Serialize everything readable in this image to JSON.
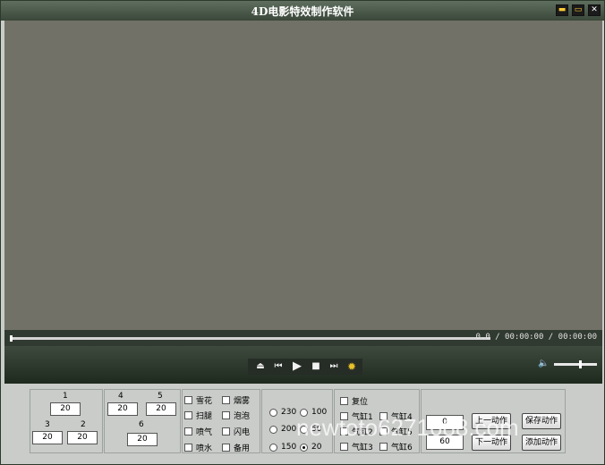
{
  "window": {
    "title": "4D电影特效制作软件",
    "min_icon": "▬",
    "max_icon": "▭",
    "close_icon": "✕"
  },
  "playback": {
    "time_text": "0.0 / 00:00:00 / 00:00:00",
    "progress": 0.0,
    "volume": 0.62,
    "icons": {
      "eject": "⏏",
      "prev": "⏮",
      "play": "▶",
      "stop": "■",
      "next": "⏭",
      "settings": "✹",
      "volume": "🔈"
    }
  },
  "panel": {
    "group1": {
      "label_1": "1",
      "value_1": "20",
      "label_3": "3",
      "value_3": "20",
      "label_2": "2",
      "value_2": "20"
    },
    "group2": {
      "label_4": "4",
      "value_4": "20",
      "label_5": "5",
      "value_5": "20",
      "label_6": "6",
      "value_6": "20"
    },
    "effects": {
      "snow": "雪花",
      "smoke": "烟雾",
      "leg_sweep": "扫腿",
      "bubbles": "泡泡",
      "air_spray": "喷气",
      "lightning": "闪电",
      "water_spray": "喷水",
      "spare": "备用"
    },
    "speeds": {
      "s230": "230",
      "s100": "100",
      "s200": "200",
      "s50": "50",
      "s150": "150",
      "s20": "20",
      "selected": "20"
    },
    "cylinders": {
      "reset": "复位",
      "cyl1": "气缸1",
      "cyl4": "气缸4",
      "cyl2": "气缸2",
      "cyl5": "气缸5",
      "cyl3": "气缸3",
      "cyl6": "气缸6"
    },
    "actions": {
      "value_top": "0",
      "value_bottom": "60",
      "prev_action": "上一动作",
      "save_action": "保存动作",
      "next_action": "下一动作",
      "add_action": "添加动作"
    }
  },
  "watermark": "newtoto6271688.com"
}
